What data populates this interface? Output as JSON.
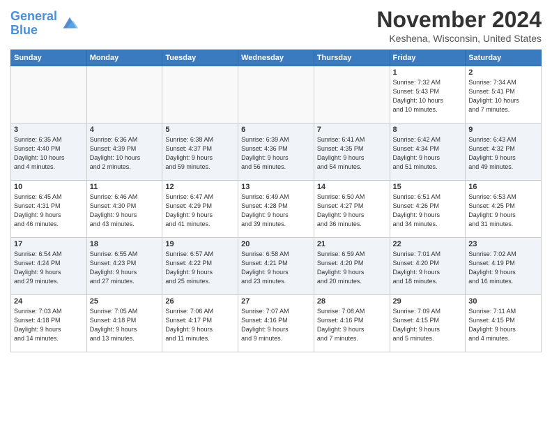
{
  "header": {
    "logo_line1": "General",
    "logo_line2": "Blue",
    "month": "November 2024",
    "location": "Keshena, Wisconsin, United States"
  },
  "weekdays": [
    "Sunday",
    "Monday",
    "Tuesday",
    "Wednesday",
    "Thursday",
    "Friday",
    "Saturday"
  ],
  "weeks": [
    [
      {
        "day": "",
        "info": ""
      },
      {
        "day": "",
        "info": ""
      },
      {
        "day": "",
        "info": ""
      },
      {
        "day": "",
        "info": ""
      },
      {
        "day": "",
        "info": ""
      },
      {
        "day": "1",
        "info": "Sunrise: 7:32 AM\nSunset: 5:43 PM\nDaylight: 10 hours\nand 10 minutes."
      },
      {
        "day": "2",
        "info": "Sunrise: 7:34 AM\nSunset: 5:41 PM\nDaylight: 10 hours\nand 7 minutes."
      }
    ],
    [
      {
        "day": "3",
        "info": "Sunrise: 6:35 AM\nSunset: 4:40 PM\nDaylight: 10 hours\nand 4 minutes."
      },
      {
        "day": "4",
        "info": "Sunrise: 6:36 AM\nSunset: 4:39 PM\nDaylight: 10 hours\nand 2 minutes."
      },
      {
        "day": "5",
        "info": "Sunrise: 6:38 AM\nSunset: 4:37 PM\nDaylight: 9 hours\nand 59 minutes."
      },
      {
        "day": "6",
        "info": "Sunrise: 6:39 AM\nSunset: 4:36 PM\nDaylight: 9 hours\nand 56 minutes."
      },
      {
        "day": "7",
        "info": "Sunrise: 6:41 AM\nSunset: 4:35 PM\nDaylight: 9 hours\nand 54 minutes."
      },
      {
        "day": "8",
        "info": "Sunrise: 6:42 AM\nSunset: 4:34 PM\nDaylight: 9 hours\nand 51 minutes."
      },
      {
        "day": "9",
        "info": "Sunrise: 6:43 AM\nSunset: 4:32 PM\nDaylight: 9 hours\nand 49 minutes."
      }
    ],
    [
      {
        "day": "10",
        "info": "Sunrise: 6:45 AM\nSunset: 4:31 PM\nDaylight: 9 hours\nand 46 minutes."
      },
      {
        "day": "11",
        "info": "Sunrise: 6:46 AM\nSunset: 4:30 PM\nDaylight: 9 hours\nand 43 minutes."
      },
      {
        "day": "12",
        "info": "Sunrise: 6:47 AM\nSunset: 4:29 PM\nDaylight: 9 hours\nand 41 minutes."
      },
      {
        "day": "13",
        "info": "Sunrise: 6:49 AM\nSunset: 4:28 PM\nDaylight: 9 hours\nand 39 minutes."
      },
      {
        "day": "14",
        "info": "Sunrise: 6:50 AM\nSunset: 4:27 PM\nDaylight: 9 hours\nand 36 minutes."
      },
      {
        "day": "15",
        "info": "Sunrise: 6:51 AM\nSunset: 4:26 PM\nDaylight: 9 hours\nand 34 minutes."
      },
      {
        "day": "16",
        "info": "Sunrise: 6:53 AM\nSunset: 4:25 PM\nDaylight: 9 hours\nand 31 minutes."
      }
    ],
    [
      {
        "day": "17",
        "info": "Sunrise: 6:54 AM\nSunset: 4:24 PM\nDaylight: 9 hours\nand 29 minutes."
      },
      {
        "day": "18",
        "info": "Sunrise: 6:55 AM\nSunset: 4:23 PM\nDaylight: 9 hours\nand 27 minutes."
      },
      {
        "day": "19",
        "info": "Sunrise: 6:57 AM\nSunset: 4:22 PM\nDaylight: 9 hours\nand 25 minutes."
      },
      {
        "day": "20",
        "info": "Sunrise: 6:58 AM\nSunset: 4:21 PM\nDaylight: 9 hours\nand 23 minutes."
      },
      {
        "day": "21",
        "info": "Sunrise: 6:59 AM\nSunset: 4:20 PM\nDaylight: 9 hours\nand 20 minutes."
      },
      {
        "day": "22",
        "info": "Sunrise: 7:01 AM\nSunset: 4:20 PM\nDaylight: 9 hours\nand 18 minutes."
      },
      {
        "day": "23",
        "info": "Sunrise: 7:02 AM\nSunset: 4:19 PM\nDaylight: 9 hours\nand 16 minutes."
      }
    ],
    [
      {
        "day": "24",
        "info": "Sunrise: 7:03 AM\nSunset: 4:18 PM\nDaylight: 9 hours\nand 14 minutes."
      },
      {
        "day": "25",
        "info": "Sunrise: 7:05 AM\nSunset: 4:18 PM\nDaylight: 9 hours\nand 13 minutes."
      },
      {
        "day": "26",
        "info": "Sunrise: 7:06 AM\nSunset: 4:17 PM\nDaylight: 9 hours\nand 11 minutes."
      },
      {
        "day": "27",
        "info": "Sunrise: 7:07 AM\nSunset: 4:16 PM\nDaylight: 9 hours\nand 9 minutes."
      },
      {
        "day": "28",
        "info": "Sunrise: 7:08 AM\nSunset: 4:16 PM\nDaylight: 9 hours\nand 7 minutes."
      },
      {
        "day": "29",
        "info": "Sunrise: 7:09 AM\nSunset: 4:15 PM\nDaylight: 9 hours\nand 5 minutes."
      },
      {
        "day": "30",
        "info": "Sunrise: 7:11 AM\nSunset: 4:15 PM\nDaylight: 9 hours\nand 4 minutes."
      }
    ]
  ]
}
